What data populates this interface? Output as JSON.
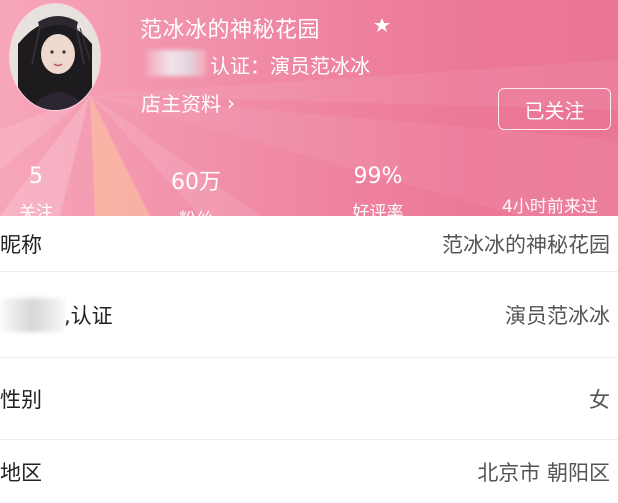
{
  "header": {
    "shop_title": "范冰冰的神秘花园",
    "verify_text": "认证：演员范冰冰",
    "owner_link": "店主资料",
    "owner_link_chevron": "›",
    "follow_button": "已关注",
    "badge_icon": "flame-badge-icon",
    "stats": [
      {
        "value": "5",
        "label": "关注"
      },
      {
        "value": "60万",
        "label": "粉丝"
      },
      {
        "value": "99%",
        "label": "好评率"
      }
    ],
    "last_visit": "4小时前来过"
  },
  "rows": [
    {
      "label": "昵称",
      "value": "范冰冰的神秘花园"
    },
    {
      "label": ",认证",
      "value": "演员范冰冰"
    },
    {
      "label": "性别",
      "value": "女"
    },
    {
      "label": "地区",
      "value": "北京市 朝阳区"
    }
  ],
  "colors": {
    "header_gradient_start": "#f7a6b9",
    "header_gradient_end": "#ea7594",
    "divider": "#ececec"
  }
}
